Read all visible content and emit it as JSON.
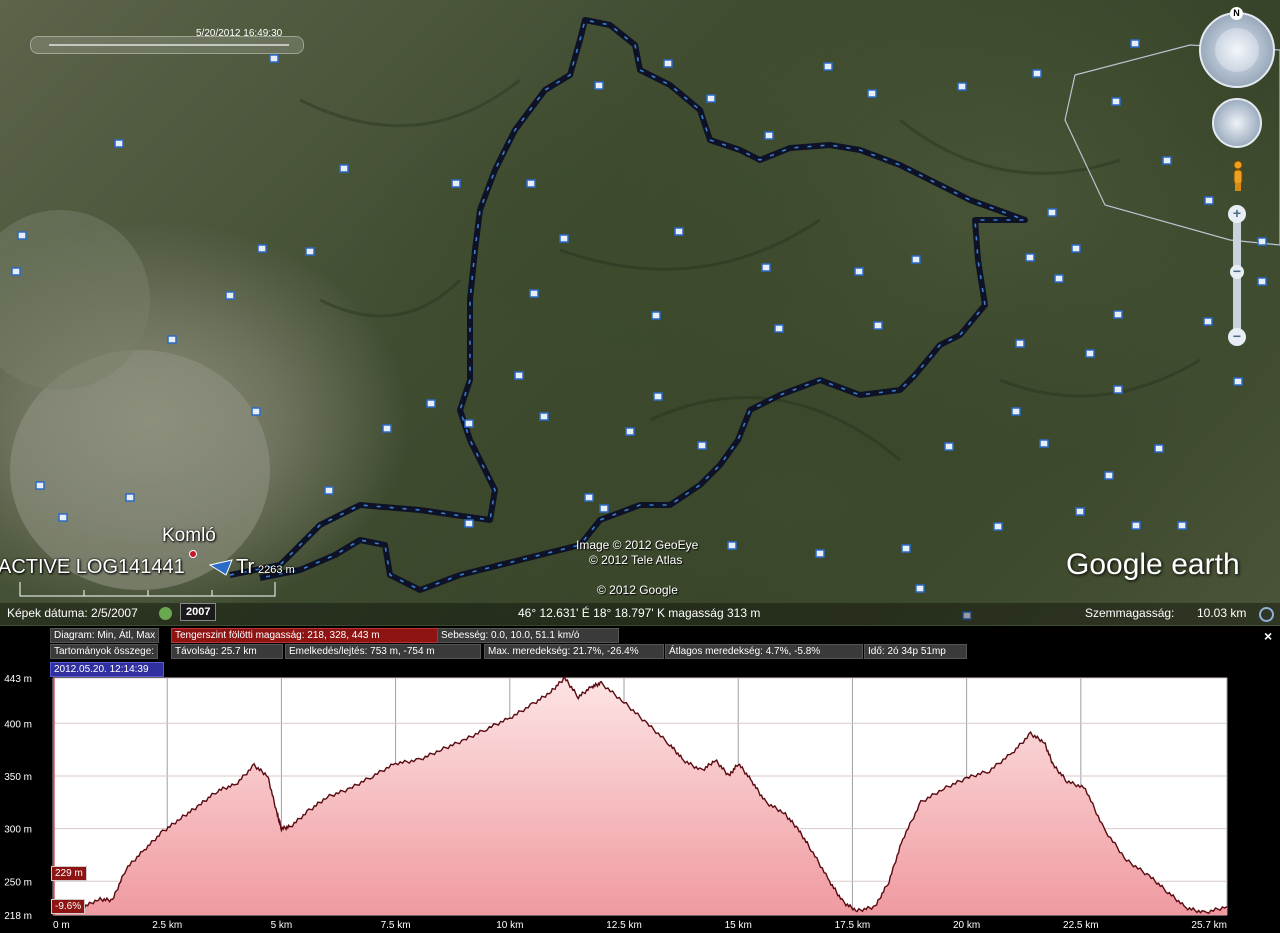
{
  "map": {
    "time_label": "5/20/2012  16:49:30",
    "place_label": "Komló",
    "track_label": "ACTIVE LOG141441",
    "track_label_suffix": "Tr",
    "track_distance": "2263 m",
    "image_credit_1": "Image © 2012 GeoEye",
    "image_credit_2": "© 2012 Tele Atlas",
    "copyright": "© 2012 Google",
    "logo_main": "Google",
    "logo_suffix": "earth",
    "compass_north": "N"
  },
  "status_bar": {
    "imagery_date": "Képek dátuma: 2/5/2007",
    "year_badge": "2007",
    "coordinates": "46° 12.631' É   18° 18.797' K  magasság   313 m",
    "eye_alt_label": "Szemmagasság:",
    "eye_alt_value": "10.03 km"
  },
  "profile": {
    "row1": {
      "diagram_label": "Diagram: Min, Átl, Max",
      "elevation": "Tengerszint fölötti magasság: 218, 328, 443 m",
      "speed": "Sebesség: 0.0, 10.0, 51.1 km/ó"
    },
    "row2": {
      "totals_label": "Tartományok összege:",
      "distance": "Távolság: 25.7 km",
      "gain_loss": "Emelkedés/lejtés: 753 m, -754 m",
      "max_slope": "Max. meredekség: 21.7%, -26.4%",
      "avg_slope": "Átlagos meredekség: 4.7%, -5.8%",
      "time": "Idő: 2ó 34p 51mp"
    },
    "timestamp": "2012.05.20. 12:14:39",
    "cursor_elevation": "229 m",
    "cursor_slope": "-9.6%",
    "close_symbol": "×"
  },
  "chart_data": {
    "type": "area",
    "title": "",
    "xlabel": "",
    "ylabel": "",
    "ylim": [
      218,
      443
    ],
    "xlim": [
      0,
      25.7
    ],
    "y_ticks": [
      "443 m",
      "400 m",
      "350 m",
      "300 m",
      "250 m",
      "218 m"
    ],
    "y_tick_values": [
      443,
      400,
      350,
      300,
      250,
      218
    ],
    "x_ticks": [
      "0 m",
      "2.5 km",
      "5 km",
      "7.5 km",
      "10 km",
      "12.5 km",
      "15 km",
      "17.5 km",
      "20 km",
      "22.5 km",
      "25.7 km"
    ],
    "x_tick_values": [
      0,
      2.5,
      5,
      7.5,
      10,
      12.5,
      15,
      17.5,
      20,
      22.5,
      25.7
    ],
    "series": [
      {
        "x": [
          0,
          0.3,
          0.6,
          1.0,
          1.3,
          1.6,
          2.0,
          2.4,
          2.8,
          3.2,
          3.6,
          4.0,
          4.4,
          4.7,
          4.9,
          5.0,
          5.2,
          5.6,
          6.0,
          6.5,
          7.0,
          7.5,
          8.0,
          8.5,
          9.0,
          9.5,
          10.0,
          10.5,
          10.9,
          11.2,
          11.5,
          11.8,
          12.0,
          12.5,
          13.0,
          13.5,
          13.8,
          14.2,
          14.5,
          14.8,
          15.0,
          15.3,
          15.6,
          16.0,
          16.3,
          16.6,
          17.0,
          17.3,
          17.6,
          18.0,
          18.3,
          18.6,
          19.0,
          19.5,
          20.0,
          20.5,
          21.0,
          21.4,
          21.7,
          21.9,
          22.2,
          22.6,
          23.0,
          23.5,
          24.0,
          24.4,
          24.8,
          25.2,
          25.7
        ],
        "y": [
          225,
          222,
          224,
          233,
          232,
          262,
          280,
          297,
          310,
          322,
          336,
          342,
          360,
          350,
          315,
          300,
          302,
          317,
          330,
          338,
          350,
          362,
          365,
          375,
          384,
          395,
          405,
          418,
          430,
          443,
          425,
          435,
          438,
          420,
          400,
          380,
          365,
          355,
          365,
          350,
          362,
          345,
          325,
          315,
          300,
          280,
          250,
          230,
          222,
          226,
          250,
          290,
          325,
          338,
          348,
          355,
          372,
          390,
          382,
          360,
          345,
          338,
          300,
          270,
          255,
          240,
          225,
          220,
          226
        ]
      }
    ]
  }
}
